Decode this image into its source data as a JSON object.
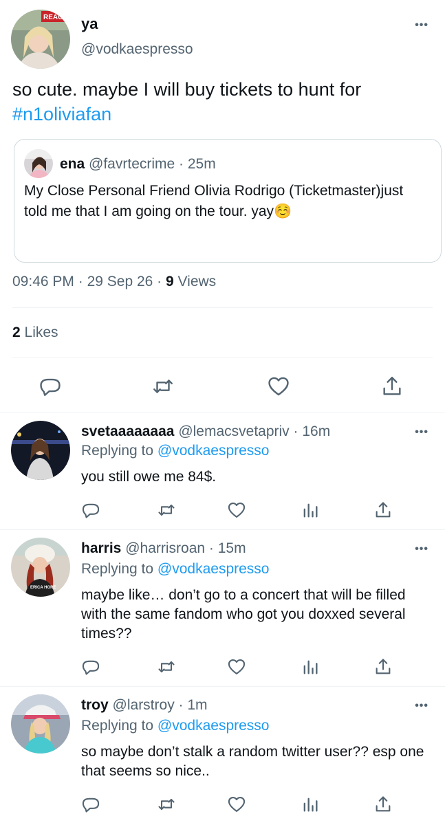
{
  "main_tweet": {
    "name": "ya",
    "handle": "@vodkaespresso",
    "text": "so cute. maybe I will buy tickets to hunt for ",
    "hashtag": "#n1oliviafan",
    "avatar_badge": "REACT",
    "quote": {
      "name": "ena",
      "handle": "@favrtecrime",
      "time": "25m",
      "text": "My Close Personal Friend Olivia Rodrigo (Ticketmaster)just told me that I am going on the tour. yay",
      "emoji": "☺️"
    },
    "timestamp": {
      "time": "09:46 PM",
      "date": "29 Sep 26",
      "views_count": "9",
      "views_label": "Views"
    },
    "likes": {
      "count": "2",
      "label": "Likes"
    }
  },
  "replies": [
    {
      "name": "svetaaaaaaaa",
      "handle": "@lemacsvetapriv",
      "time": "16m",
      "replying_label": "Replying to",
      "replying_to": "@vodkaespresso",
      "text": "you still owe me 84$."
    },
    {
      "name": "harris",
      "handle": "@harrisroan",
      "time": "15m",
      "replying_label": "Replying to",
      "replying_to": "@vodkaespresso",
      "text": "maybe like… don’t go to a concert that will be filled with the same fandom who got you doxxed several times??",
      "avatar_badge": "ERICA HORE"
    },
    {
      "name": "troy",
      "handle": "@larstroy",
      "time": "1m",
      "replying_label": "Replying to",
      "replying_to": "@vodkaespresso",
      "text": "so maybe don’t stalk a random twitter user?? esp one that seems so nice.."
    }
  ],
  "more_label": "•••",
  "separator": " · ",
  "colors": {
    "accent": "#1d9bf0",
    "secondary_text": "#536471",
    "primary_text": "#0f1419",
    "border": "#cfd9de",
    "divider": "#eff3f4"
  },
  "icons": [
    "reply-icon",
    "retweet-icon",
    "like-icon",
    "share-icon",
    "analytics-icon",
    "more-icon"
  ]
}
